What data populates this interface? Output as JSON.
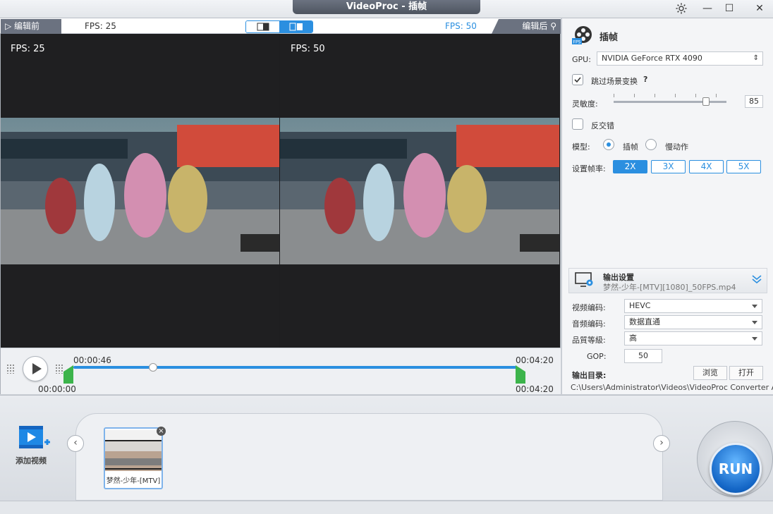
{
  "app": {
    "title": "VideoProc - 插帧"
  },
  "preview": {
    "before_label": "编辑前",
    "after_label": "编辑后",
    "fps_before": "FPS: 25",
    "fps_after": "FPS: 50",
    "fps_before_overlay": "FPS: 25",
    "fps_after_overlay": "FPS: 50",
    "colors": {
      "after_fps": "#2b8fe0"
    }
  },
  "timeline": {
    "current_time": "00:00:46",
    "start_time": "00:00:00",
    "end_time_top": "00:04:20",
    "end_time_bottom": "00:04:20",
    "progress": 0.18
  },
  "settings": {
    "panel_title": "插帧",
    "gpu_label": "GPU:",
    "gpu_value": "NVIDIA GeForce RTX 4090",
    "skip_scene_label": "跳过场景变换",
    "skip_scene_checked": true,
    "help_glyph": "?",
    "sensitivity_label": "灵敏度:",
    "sensitivity_value": "85",
    "deinterlace_label": "反交错",
    "deinterlace_checked": false,
    "model_label": "模型:",
    "model_options": [
      "插帧",
      "慢动作"
    ],
    "model_selected": "插帧",
    "framerate_label": "设置帧率:",
    "multipliers": [
      "2X",
      "3X",
      "4X",
      "5X"
    ],
    "multiplier_selected": "2X"
  },
  "output": {
    "header_title": "输出设置",
    "filename": "梦然-少年-[MTV][1080]_50FPS.mp4",
    "video_codec_label": "视频编码:",
    "video_codec_value": "HEVC",
    "audio_codec_label": "音频编码:",
    "audio_codec_value": "数据直通",
    "quality_label": "品質等級:",
    "quality_value": "高",
    "gop_label": "GOP:",
    "gop_value": "50",
    "dir_label": "输出目录:",
    "browse_label": "浏览",
    "open_label": "打开",
    "dir_path": "C:\\Users\\Administrator\\Videos\\VideoProc Converter AI"
  },
  "bottom": {
    "add_video_label": "添加视频",
    "clip_name": "梦然-少年-[MTV]",
    "clip_close": "×",
    "prev_glyph": "‹",
    "next_glyph": "›",
    "run_label": "RUN"
  }
}
